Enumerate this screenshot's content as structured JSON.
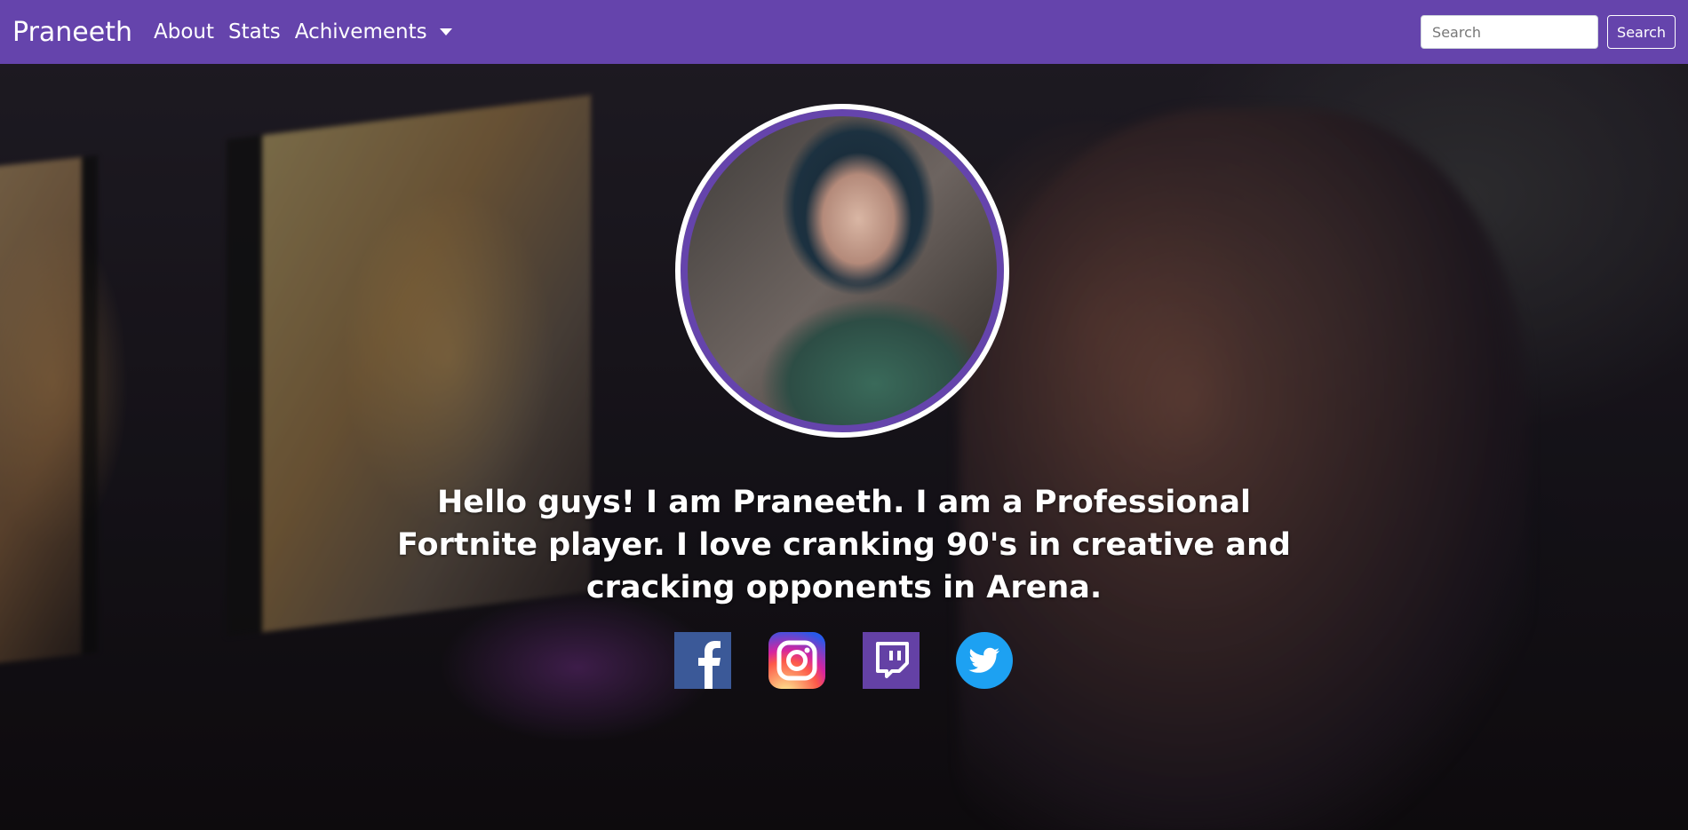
{
  "navbar": {
    "brand": "Praneeth",
    "links": [
      {
        "label": "About"
      },
      {
        "label": "Stats"
      },
      {
        "label": "Achivements"
      }
    ],
    "search": {
      "placeholder": "Search",
      "button_label": "Search"
    },
    "background_color": "#6544ac"
  },
  "hero": {
    "bio": "Hello guys! I am Praneeth. I am a Professional Fortnite player. I love cranking 90's in creative and cracking opponents in Arena.",
    "socials": [
      {
        "icon": "facebook-icon",
        "color": "#3b5998"
      },
      {
        "icon": "instagram-icon",
        "color": "#d6249f"
      },
      {
        "icon": "twitch-icon",
        "color": "#6441a5"
      },
      {
        "icon": "twitter-icon",
        "color": "#1da1f2"
      }
    ]
  }
}
